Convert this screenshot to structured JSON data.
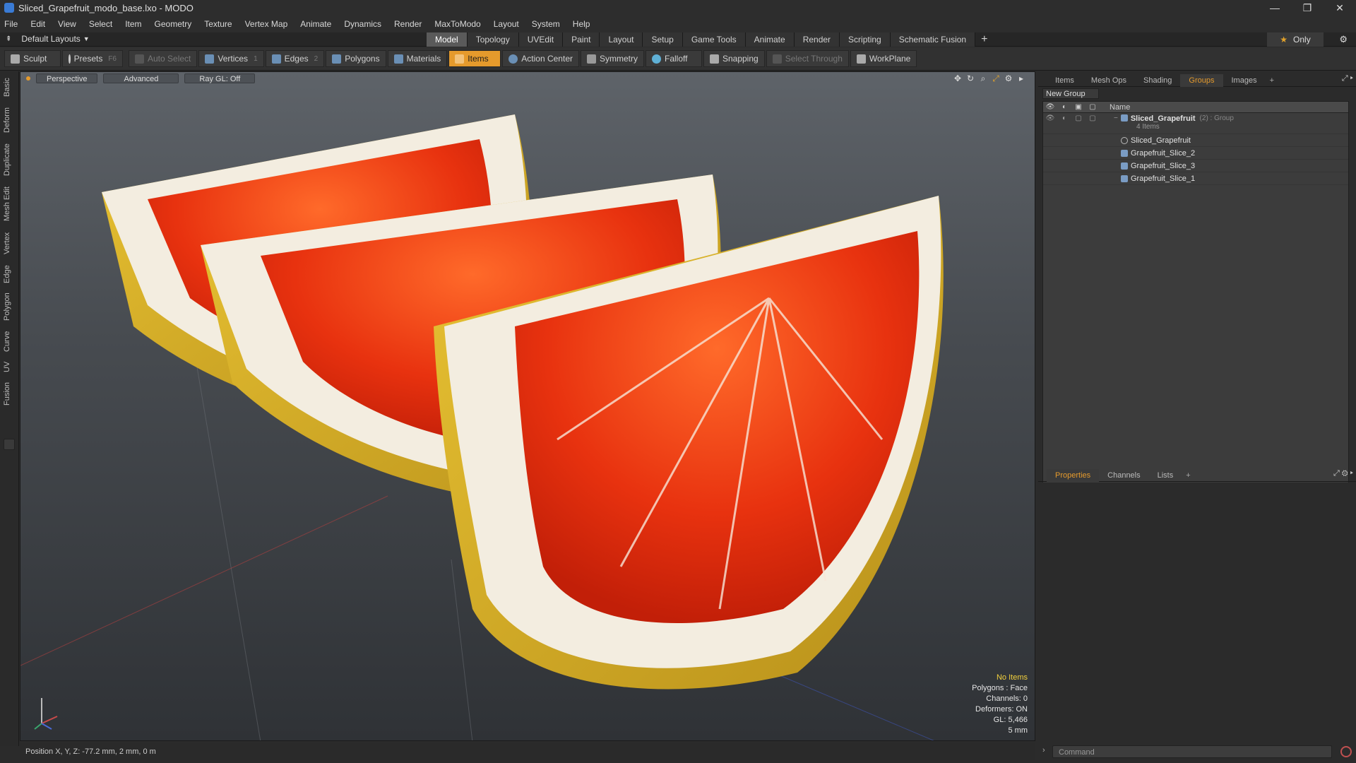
{
  "window": {
    "title": "Sliced_Grapefruit_modo_base.lxo - MODO"
  },
  "menu": [
    "File",
    "Edit",
    "View",
    "Select",
    "Item",
    "Geometry",
    "Texture",
    "Vertex Map",
    "Animate",
    "Dynamics",
    "Render",
    "MaxToModo",
    "Layout",
    "System",
    "Help"
  ],
  "layouts": {
    "selected": "Default Layouts"
  },
  "mode_tabs": [
    "Model",
    "Topology",
    "UVEdit",
    "Paint",
    "Layout",
    "Setup",
    "Game Tools",
    "Animate",
    "Render",
    "Scripting",
    "Schematic Fusion"
  ],
  "only_label": "Only",
  "toolbar": {
    "sculpt": "Sculpt",
    "presets": "Presets",
    "presets_key": "F6",
    "auto_select": "Auto Select",
    "vertices": "Vertices",
    "vertices_key": "1",
    "edges": "Edges",
    "edges_key": "2",
    "polygons": "Polygons",
    "materials": "Materials",
    "items": "Items",
    "action_center": "Action Center",
    "symmetry": "Symmetry",
    "falloff": "Falloff",
    "snapping": "Snapping",
    "select_through": "Select Through",
    "workplane": "WorkPlane"
  },
  "left_tabs": [
    "Basic",
    "Deform",
    "Duplicate",
    "Mesh Edit",
    "Vertex",
    "Edge",
    "Polygon",
    "Curve",
    "UV",
    "Fusion"
  ],
  "viewport": {
    "view": "Perspective",
    "mode": "Advanced",
    "raygl": "Ray GL: Off",
    "info": {
      "items": "No Items",
      "polygons": "Polygons : Face",
      "channels": "Channels: 0",
      "deformers": "Deformers: ON",
      "gl": "GL: 5,466",
      "grid": "5 mm"
    }
  },
  "status": {
    "position": "Position X, Y, Z:  -77.2 mm, 2 mm, 0 m"
  },
  "right_panel": {
    "tabs": [
      "Items",
      "Mesh Ops",
      "Shading",
      "Groups",
      "Images"
    ],
    "active_tab": "Groups",
    "new_group": "New Group",
    "name_header": "Name",
    "group": {
      "name": "Sliced_Grapefruit",
      "suffix": "(2) : Group",
      "count": "4 Items"
    },
    "items": [
      "Sliced_Grapefruit",
      "Grapefruit_Slice_2",
      "Grapefruit_Slice_3",
      "Grapefruit_Slice_1"
    ],
    "props_tabs": [
      "Properties",
      "Channels",
      "Lists"
    ],
    "command_placeholder": "Command"
  }
}
